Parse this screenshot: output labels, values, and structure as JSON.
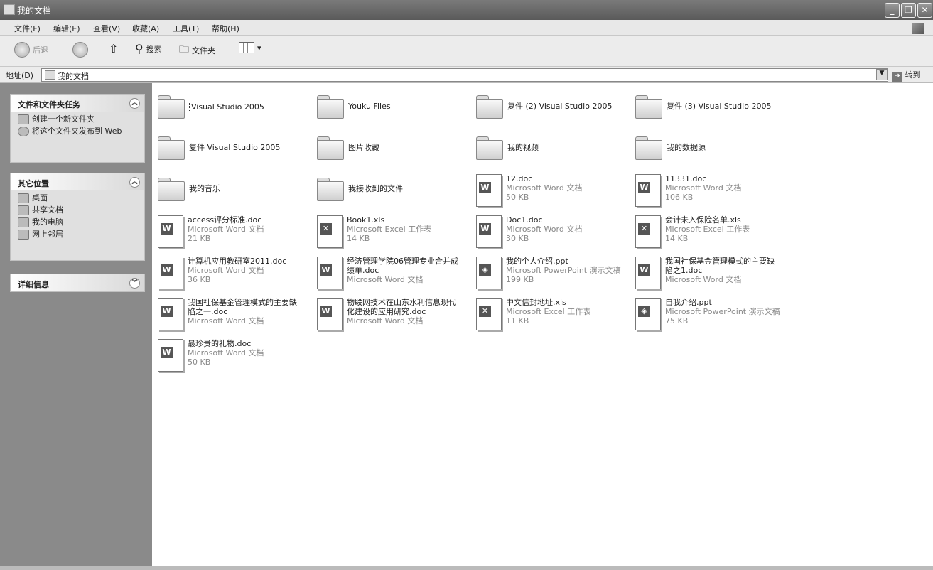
{
  "window": {
    "title": "我的文档"
  },
  "menu": [
    "文件(F)",
    "编辑(E)",
    "查看(V)",
    "收藏(A)",
    "工具(T)",
    "帮助(H)"
  ],
  "toolbar": {
    "back": "后退",
    "search": "搜索",
    "folders": "文件夹"
  },
  "address": {
    "label": "地址(D)",
    "value": "我的文档",
    "go": "转到"
  },
  "panels": {
    "tasks": {
      "title": "文件和文件夹任务",
      "items": [
        "创建一个新文件夹",
        "将这个文件夹发布到 Web"
      ]
    },
    "places": {
      "title": "其它位置",
      "items": [
        "桌面",
        "共享文档",
        "我的电脑",
        "网上邻居"
      ]
    },
    "details": {
      "title": "详细信息"
    }
  },
  "items": [
    {
      "name": "Visual Studio 2005",
      "type": "folder"
    },
    {
      "name": "Youku Files",
      "type": "folder"
    },
    {
      "name": "复件 (2) Visual Studio 2005",
      "type": "folder"
    },
    {
      "name": "复件 (3) Visual Studio 2005",
      "type": "folder"
    },
    {
      "name": "复件 Visual Studio 2005",
      "type": "folder"
    },
    {
      "name": "图片收藏",
      "type": "folder"
    },
    {
      "name": "我的视频",
      "type": "folder"
    },
    {
      "name": "我的数据源",
      "type": "folder"
    },
    {
      "name": "我的音乐",
      "type": "folder"
    },
    {
      "name": "我接收到的文件",
      "type": "folder"
    },
    {
      "name": "12.doc",
      "type": "doc",
      "kind": "Microsoft Word 文档",
      "size": "50 KB"
    },
    {
      "name": "11331.doc",
      "type": "doc",
      "kind": "Microsoft Word 文档",
      "size": "106 KB"
    },
    {
      "name": "access评分标准.doc",
      "type": "doc",
      "kind": "Microsoft Word 文档",
      "size": "21 KB"
    },
    {
      "name": "Book1.xls",
      "type": "xls",
      "kind": "Microsoft Excel 工作表",
      "size": "14 KB"
    },
    {
      "name": "Doc1.doc",
      "type": "doc",
      "kind": "Microsoft Word 文档",
      "size": "30 KB"
    },
    {
      "name": "会计未入保险名单.xls",
      "type": "xls",
      "kind": "Microsoft Excel 工作表",
      "size": "14 KB"
    },
    {
      "name": "计算机应用教研室2011.doc",
      "type": "doc",
      "kind": "Microsoft Word 文档",
      "size": "36 KB"
    },
    {
      "name": "经济管理学院06管理专业合并成绩单.doc",
      "type": "doc",
      "kind": "Microsoft Word 文档",
      "size": ""
    },
    {
      "name": "我的个人介绍.ppt",
      "type": "ppt",
      "kind": "Microsoft PowerPoint 演示文稿",
      "size": "199 KB"
    },
    {
      "name": "我国社保基金管理模式的主要缺陷之1.doc",
      "type": "doc",
      "kind": "Microsoft Word 文档",
      "size": ""
    },
    {
      "name": "我国社保基金管理模式的主要缺陷之一.doc",
      "type": "doc",
      "kind": "Microsoft Word 文档",
      "size": ""
    },
    {
      "name": "物联网技术在山东水利信息现代化建设的应用研究.doc",
      "type": "doc",
      "kind": "Microsoft Word 文档",
      "size": ""
    },
    {
      "name": "中文信封地址.xls",
      "type": "xls",
      "kind": "Microsoft Excel 工作表",
      "size": "11 KB"
    },
    {
      "name": "自我介绍.ppt",
      "type": "ppt",
      "kind": "Microsoft PowerPoint 演示文稿",
      "size": "75 KB"
    },
    {
      "name": "最珍贵的礼物.doc",
      "type": "doc",
      "kind": "Microsoft Word 文档",
      "size": "50 KB"
    }
  ]
}
